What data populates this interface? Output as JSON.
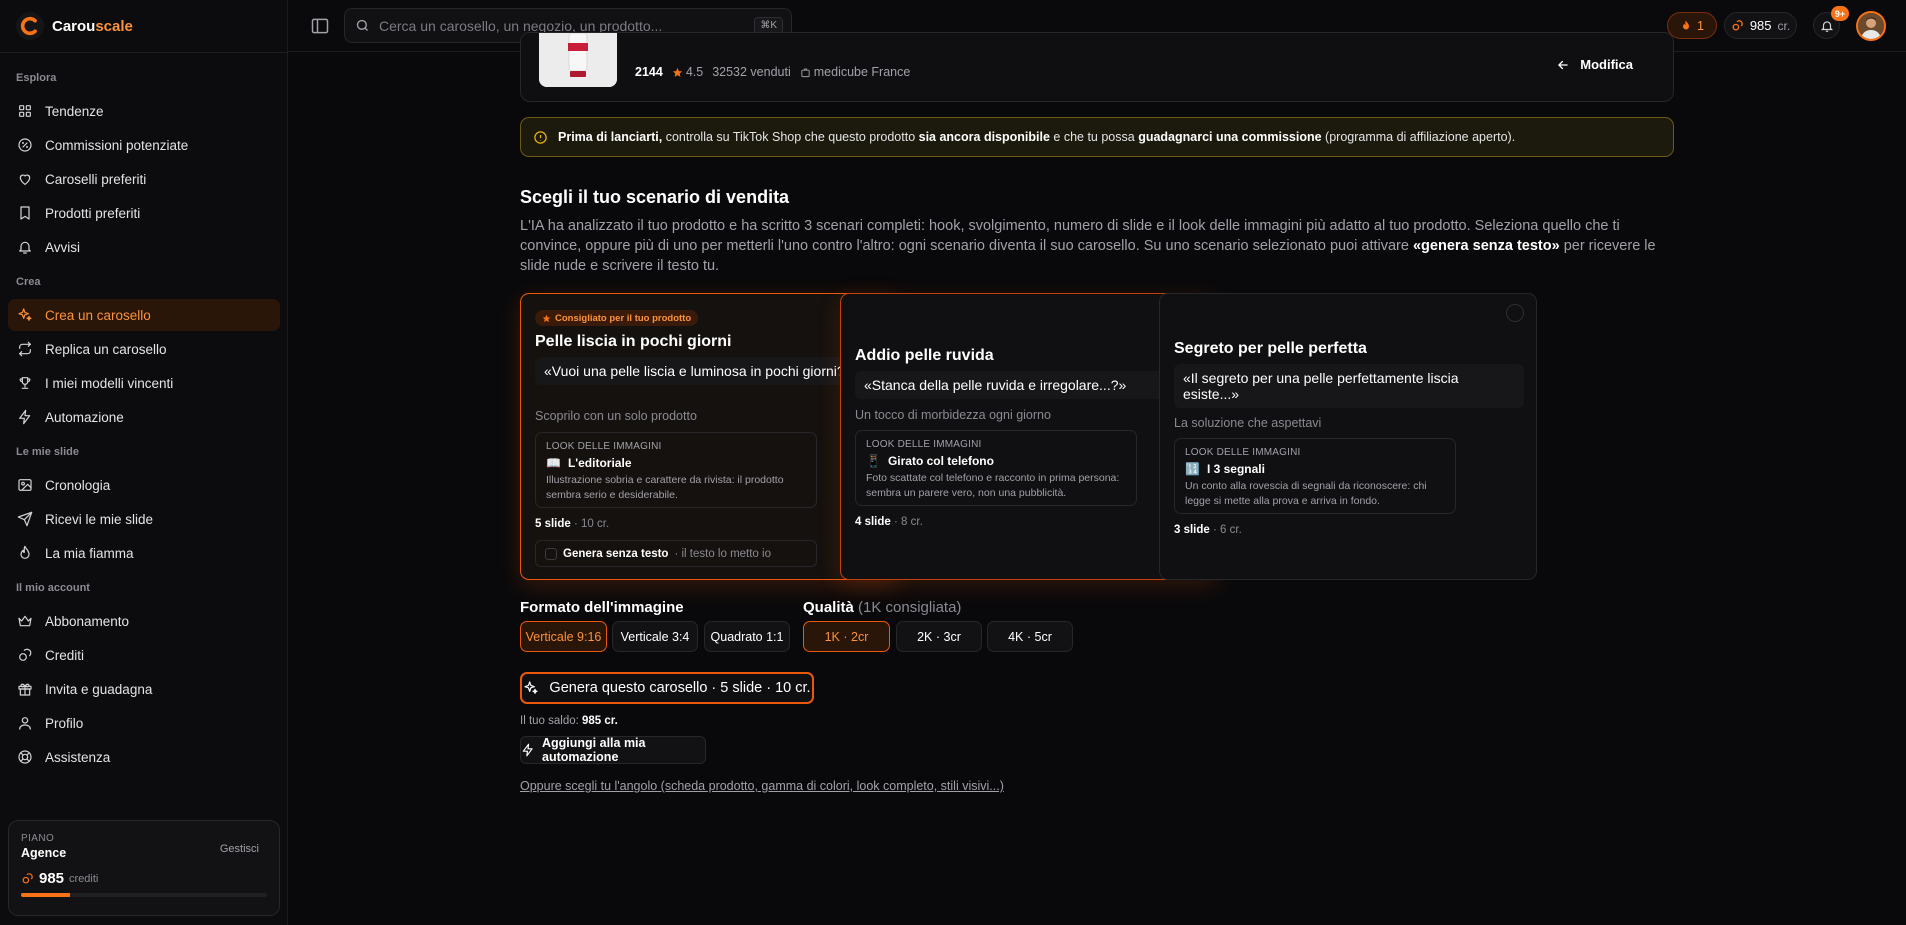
{
  "app": {
    "logo_part1": "Carou",
    "logo_part2": "scale"
  },
  "topbar": {
    "search_placeholder": "Cerca un carosello, un negozio, un prodotto...",
    "search_shortcut": "⌘K",
    "streak": "1",
    "credits": "985",
    "credits_unit": "cr.",
    "notifications_badge": "9+"
  },
  "sidebar": {
    "sections": [
      {
        "title": "Esplora",
        "items": [
          {
            "label": "Tendenze",
            "icon": "grid-icon"
          },
          {
            "label": "Commissioni potenziate",
            "icon": "percent-icon"
          },
          {
            "label": "Caroselli preferiti",
            "icon": "heart-icon"
          },
          {
            "label": "Prodotti preferiti",
            "icon": "bookmark-icon"
          },
          {
            "label": "Avvisi",
            "icon": "bell-icon"
          }
        ]
      },
      {
        "title": "Crea",
        "items": [
          {
            "label": "Crea un carosello",
            "icon": "sparkles-icon",
            "active": true
          },
          {
            "label": "Replica un carosello",
            "icon": "repeat-icon"
          },
          {
            "label": "I miei modelli vincenti",
            "icon": "trophy-icon"
          },
          {
            "label": "Automazione",
            "icon": "zap-icon"
          }
        ]
      },
      {
        "title": "Le mie slide",
        "items": [
          {
            "label": "Cronologia",
            "icon": "image-icon"
          },
          {
            "label": "Ricevi le mie slide",
            "icon": "send-icon"
          },
          {
            "label": "La mia fiamma",
            "icon": "flame-icon"
          }
        ]
      },
      {
        "title": "Il mio account",
        "items": [
          {
            "label": "Abbonamento",
            "icon": "crown-icon"
          },
          {
            "label": "Crediti",
            "icon": "coins-icon"
          },
          {
            "label": "Invita e guadagna",
            "icon": "gift-icon"
          },
          {
            "label": "Profilo",
            "icon": "user-icon"
          },
          {
            "label": "Assistenza",
            "icon": "lifebuoy-icon"
          }
        ]
      }
    ],
    "plan": {
      "label": "PIANO",
      "name": "Agence",
      "manage": "Gestisci",
      "credits": "985",
      "credits_unit": "crediti",
      "usage_fraction": 0.2
    }
  },
  "product": {
    "id": "2144",
    "rating": "4.5",
    "sold": "32532 venduti",
    "shop": "medicube France",
    "modify": "Modifica"
  },
  "alert": {
    "b1": "Prima di lanciarti,",
    "t1": " controlla su TikTok Shop che questo prodotto ",
    "b2": "sia ancora disponibile",
    "t2": " e che tu possa ",
    "b3": "guadagnarci una commissione",
    "t3": " (programma di affiliazione aperto)."
  },
  "scenarios_section": {
    "title": "Scegli il tuo scenario di vendita",
    "desc": "L'IA ha analizzato il tuo prodotto e ha scritto 3 scenari completi: hook, svolgimento, numero di slide e il look delle immagini più adatto al tuo prodotto. Seleziona quello che ti convince, oppure più di uno per metterli l'uno contro l'altro: ogni scenario diventa il suo carosello. Su uno scenario selezionato puoi attivare ",
    "desc_bold": "«genera senza testo»",
    "desc_end": " per ricevere le slide nude e scrivere il testo tu."
  },
  "scenarios": [
    {
      "badge": "Consigliato per il tuo prodotto",
      "title": "Pelle liscia in pochi giorni",
      "hook": "«Vuoi una pelle liscia e luminosa in pochi giorni?»",
      "sub": "Scoprilo con un solo prodotto",
      "look_label": "LOOK DELLE IMMAGINI",
      "look_emoji": "📖",
      "look_name": "L'editoriale",
      "look_desc": "Illustrazione sobria e carattere da rivista: il prodotto sembra serio e desiderabile.",
      "slides": "5 slide",
      "cost": " · 10 cr.",
      "notext_label": "Genera senza testo",
      "notext_sub": " · il testo lo metto io"
    },
    {
      "title": "Addio pelle ruvida",
      "hook": "«Stanca della pelle ruvida e irregolare...?»",
      "sub": "Un tocco di morbidezza ogni giorno",
      "look_label": "LOOK DELLE IMMAGINI",
      "look_emoji": "📱",
      "look_name": "Girato col telefono",
      "look_desc": "Foto scattate col telefono e racconto in prima persona: sembra un parere vero, non una pubblicità.",
      "slides": "4 slide",
      "cost": " · 8 cr."
    },
    {
      "title": "Segreto per pelle perfetta",
      "hook": "«Il segreto per una pelle perfettamente liscia esiste...»",
      "sub": "La soluzione che aspettavi",
      "look_label": "LOOK DELLE IMMAGINI",
      "look_emoji": "🔢",
      "look_name": "I 3 segnali",
      "look_desc": "Un conto alla rovescia di segnali da riconoscere: chi legge si mette alla prova e arriva in fondo.",
      "slides": "3 slide",
      "cost": " · 6 cr."
    }
  ],
  "format": {
    "title": "Formato dell'immagine",
    "options": [
      "Verticale 9:16",
      "Verticale 3:4",
      "Quadrato 1:1"
    ],
    "selected": "Verticale 9:16"
  },
  "quality": {
    "title": "Qualità",
    "hint": "(1K consigliata)",
    "options": [
      "1K · 2cr",
      "2K · 3cr",
      "4K · 5cr"
    ],
    "selected": "1K · 2cr"
  },
  "actions": {
    "generate": "Genera questo carosello · 5 slide · 10 cr.",
    "saldo_label": "Il tuo saldo: ",
    "saldo_value": "985 cr.",
    "automation": "Aggiungi alla mia automazione",
    "angle_link": "Oppure scegli tu l'angolo (scheda prodotto, gamma di colori, look completo, stili visivi...)"
  }
}
